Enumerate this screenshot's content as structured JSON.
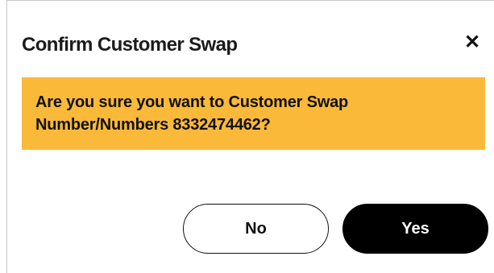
{
  "dialog": {
    "title": "Confirm Customer Swap",
    "close_label": "✕",
    "message": "Are you sure you want to Customer Swap Number/Numbers 8332474462?",
    "banner_color": "#fbb93a"
  },
  "actions": {
    "no_label": "No",
    "yes_label": "Yes"
  }
}
